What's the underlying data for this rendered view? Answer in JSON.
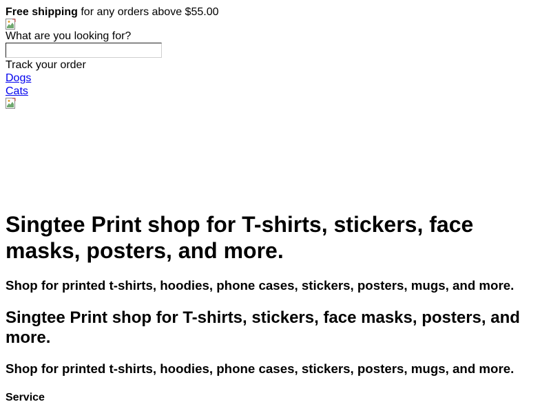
{
  "promo": {
    "bold": "Free shipping",
    "rest": " for any orders above $55.00"
  },
  "search": {
    "label": "What are you looking for?",
    "value": "",
    "placeholder": ""
  },
  "track_order": "Track your order",
  "nav": {
    "dogs": "Dogs",
    "cats": "Cats"
  },
  "hero": {
    "title": "Singtee Print shop for T-shirts, stickers, face masks, posters, and more.",
    "subtitle": "Shop for printed t-shirts, hoodies, phone cases, stickers, posters, mugs, and more.",
    "title2": "Singtee Print shop for T-shirts, stickers, face masks, posters, and more.",
    "subtitle2": "Shop for printed t-shirts, hoodies, phone cases, stickers, posters, mugs, and more."
  },
  "footer": {
    "service_heading": "Service"
  },
  "icons": {
    "logo": "broken-image-icon",
    "banner": "broken-image-icon"
  }
}
